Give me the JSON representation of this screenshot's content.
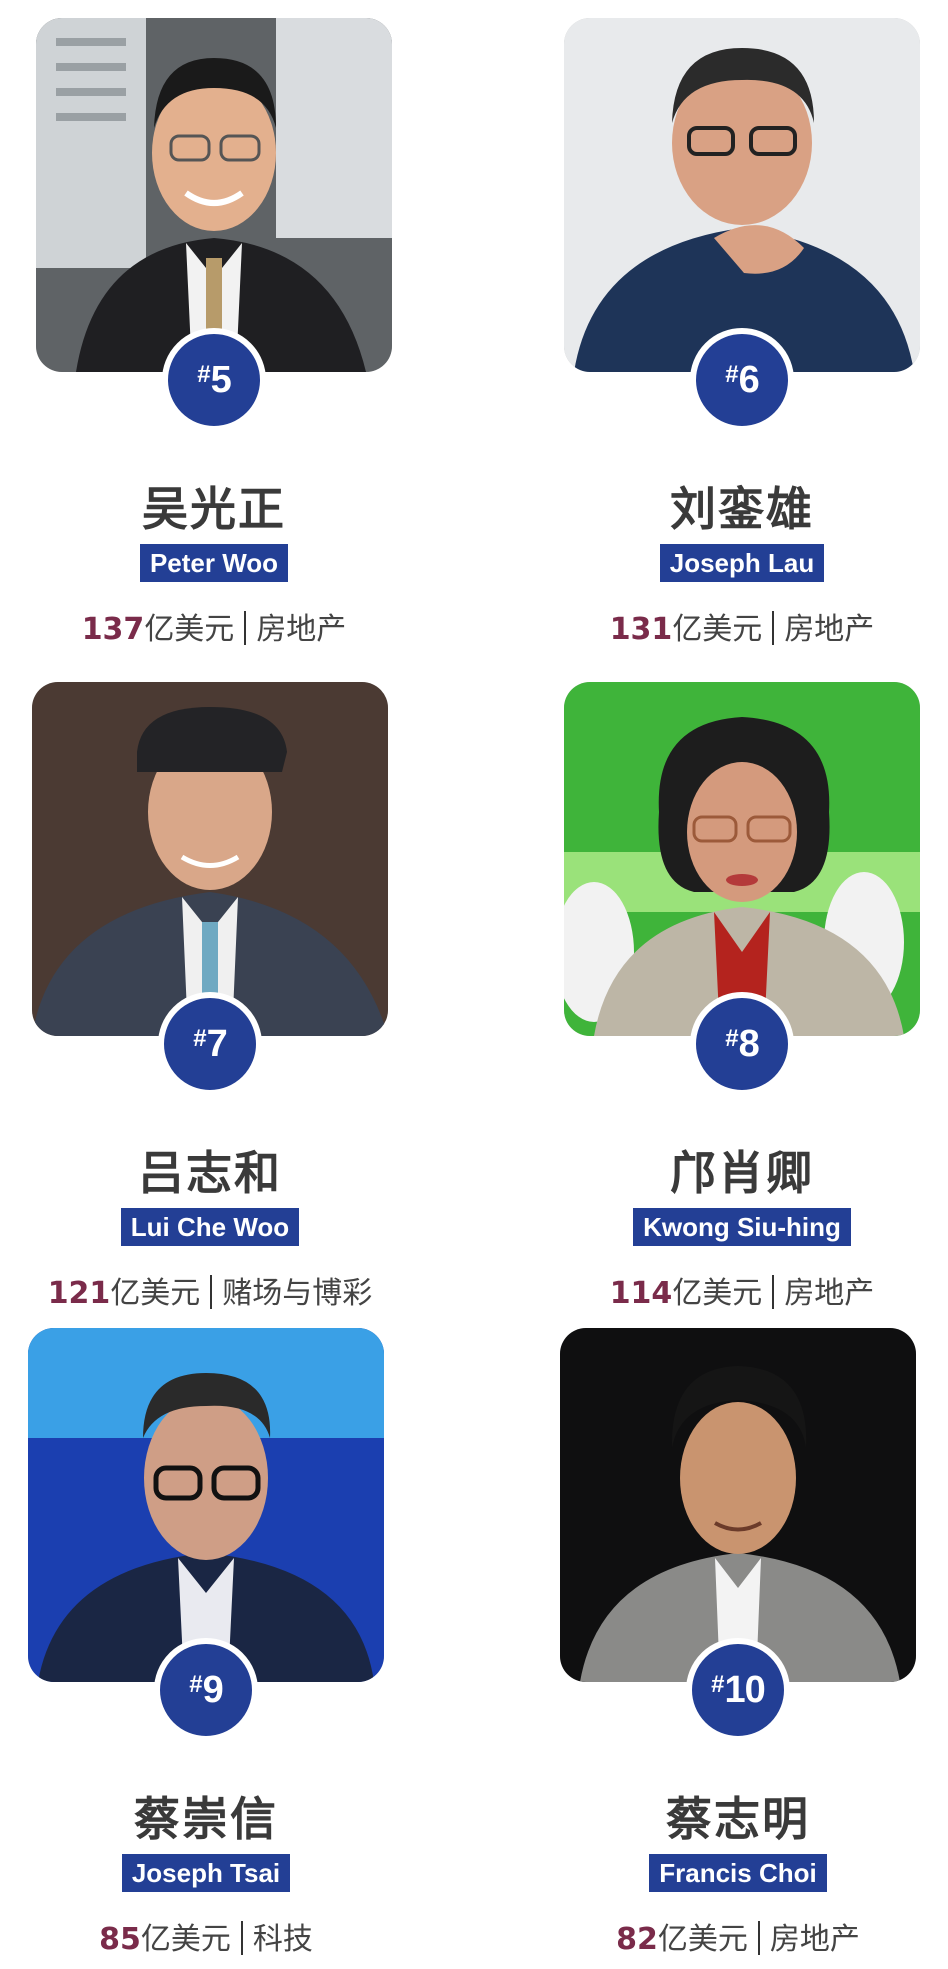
{
  "colors": {
    "badge": "#233f95",
    "amount": "#7a2b4a",
    "text": "#3a3a3a"
  },
  "people": [
    {
      "rank": "5",
      "cn_name": "吴光正",
      "en_name": "Peter Woo",
      "amount": "137",
      "unit": "亿美元",
      "industry": "房地产"
    },
    {
      "rank": "6",
      "cn_name": "刘銮雄",
      "en_name": "Joseph Lau",
      "amount": "131",
      "unit": "亿美元",
      "industry": "房地产"
    },
    {
      "rank": "7",
      "cn_name": "吕志和",
      "en_name": "Lui Che Woo",
      "amount": "121",
      "unit": "亿美元",
      "industry": "赌场与博彩"
    },
    {
      "rank": "8",
      "cn_name": "邝肖卿",
      "en_name": "Kwong Siu-hing",
      "amount": "114",
      "unit": "亿美元",
      "industry": "房地产"
    },
    {
      "rank": "9",
      "cn_name": "蔡崇信",
      "en_name": "Joseph Tsai",
      "amount": "85",
      "unit": "亿美元",
      "industry": "科技"
    },
    {
      "rank": "10",
      "cn_name": "蔡志明",
      "en_name": "Francis Choi",
      "amount": "82",
      "unit": "亿美元",
      "industry": "房地产"
    }
  ]
}
